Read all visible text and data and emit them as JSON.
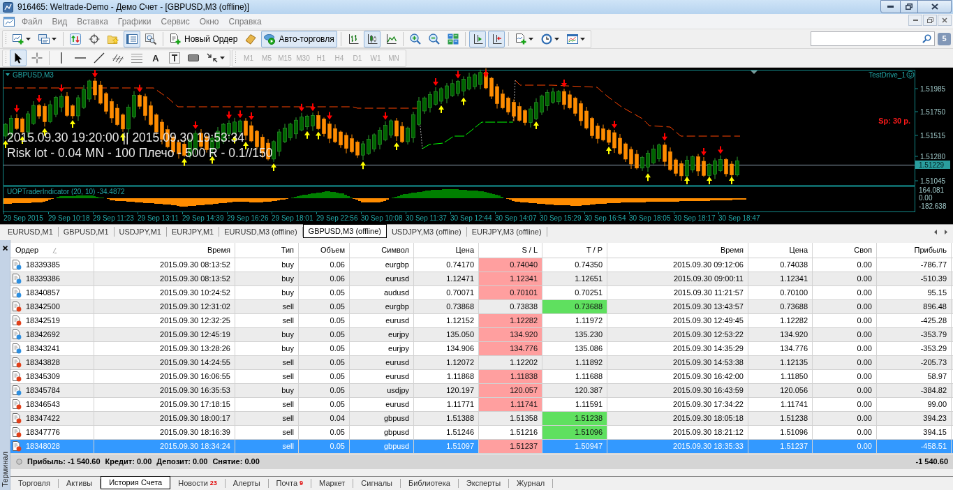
{
  "window": {
    "title": "916465: Weltrade-Demo - Демо Счет - [GBPUSD,M3 (offline)]"
  },
  "menu": [
    "Файл",
    "Вид",
    "Вставка",
    "Графики",
    "Сервис",
    "Окно",
    "Справка"
  ],
  "toolbar": {
    "groups": [
      [
        {
          "kind": "newchart",
          "pressed": false,
          "dropdown": true
        },
        {
          "kind": "profiles",
          "pressed": false,
          "dropdown": true
        }
      ],
      [
        {
          "kind": "market",
          "pressed": false
        },
        {
          "kind": "navigator",
          "pressed": false
        },
        {
          "kind": "favorites",
          "pressed": false
        },
        {
          "kind": "terminal",
          "pressed": true
        },
        {
          "kind": "tester",
          "pressed": false
        }
      ],
      [
        {
          "kind": "order",
          "label": "Новый Ордер",
          "pressed": false
        },
        {
          "kind": "editor",
          "pressed": false
        },
        {
          "kind": "autotrade",
          "label": "Авто-торговля",
          "pressed": true
        }
      ],
      [
        {
          "kind": "bars",
          "pressed": false
        },
        {
          "kind": "candles",
          "pressed": true
        },
        {
          "kind": "line",
          "pressed": false
        }
      ],
      [
        {
          "kind": "zoomin",
          "pressed": false
        },
        {
          "kind": "zoomout",
          "pressed": false
        },
        {
          "kind": "tile",
          "pressed": false
        }
      ],
      [
        {
          "kind": "shift",
          "pressed": true
        },
        {
          "kind": "autoscroll",
          "pressed": true
        }
      ],
      [
        {
          "kind": "indicators",
          "pressed": false,
          "dropdown": true
        },
        {
          "kind": "periods",
          "pressed": false,
          "dropdown": true
        },
        {
          "kind": "templates",
          "pressed": false,
          "dropdown": true
        }
      ]
    ]
  },
  "notifications": "5",
  "drawing_tools": {
    "groups": [
      [
        {
          "kind": "cursor",
          "selected": true
        },
        {
          "kind": "crosshair",
          "selected": false
        }
      ],
      [
        {
          "kind": "vline",
          "selected": false
        },
        {
          "kind": "hline",
          "selected": false
        },
        {
          "kind": "trendline",
          "selected": false
        },
        {
          "kind": "fibofan",
          "selected": false
        },
        {
          "kind": "fibo",
          "selected": false
        },
        {
          "kind": "text",
          "glyph": "A",
          "selected": false
        },
        {
          "kind": "label",
          "selected": false
        },
        {
          "kind": "rectangle",
          "selected": false
        },
        {
          "kind": "arrows",
          "selected": false,
          "dropdown": true
        }
      ]
    ]
  },
  "timeframes": [
    {
      "label": "M1",
      "disabled": true
    },
    {
      "label": "M5",
      "disabled": true
    },
    {
      "label": "M15",
      "disabled": true
    },
    {
      "label": "M30",
      "disabled": true
    },
    {
      "label": "H1",
      "disabled": true
    },
    {
      "label": "H4",
      "disabled": true
    },
    {
      "label": "D1",
      "disabled": true
    },
    {
      "label": "W1",
      "disabled": true
    },
    {
      "label": "MN",
      "disabled": true
    }
  ],
  "chart": {
    "symbol": "GBPUSD,M3",
    "expert": "TestDrive_1",
    "spread": "Sp: 30 p.",
    "info_lines": [
      "2015.09.30 19:20:00 || 2015.09.30 19:53:34",
      "Risk lot - 0.04 MN - 100 Плечо - 500 R - 0.1//150"
    ],
    "price_ticks": [
      "1.51985",
      "1.51750",
      "1.51515",
      "1.51280",
      "1.51045"
    ],
    "current_price": "1.51229",
    "indicator": {
      "label": "UOPTraderIndicator (20, 10) -34.4872",
      "ticks": [
        "164.081",
        "0.00",
        "-182.638"
      ]
    },
    "time_labels": [
      "29 Sep 2015",
      "29 Sep 10:18",
      "29 Sep 11:23",
      "29 Sep 13:11",
      "29 Sep 14:39",
      "29 Sep 16:26",
      "29 Sep 18:01",
      "29 Sep 22:56",
      "30 Sep 10:08",
      "30 Sep 11:37",
      "30 Sep 12:44",
      "30 Sep 14:07",
      "30 Sep 15:29",
      "30 Sep 16:54",
      "30 Sep 18:05",
      "30 Sep 18:17",
      "30 Sep 18:47"
    ]
  },
  "chart_tabs": [
    {
      "label": "EURUSD,M1",
      "selected": false
    },
    {
      "label": "GBPUSD,M1",
      "selected": false
    },
    {
      "label": "USDJPY,M1",
      "selected": false
    },
    {
      "label": "EURJPY,M1",
      "selected": false
    },
    {
      "label": "EURUSD,M3 (offline)",
      "selected": false
    },
    {
      "label": "GBPUSD,M3 (offline)",
      "selected": true
    },
    {
      "label": "USDJPY,M3 (offline)",
      "selected": false
    },
    {
      "label": "EURJPY,M3 (offline)",
      "selected": false
    }
  ],
  "terminal": {
    "title": "Терминал",
    "columns": [
      {
        "label": "Ордер",
        "sorted": true
      },
      {
        "label": "Время",
        "sorted": false
      },
      {
        "label": "Тип",
        "sorted": false
      },
      {
        "label": "Объем",
        "sorted": false
      },
      {
        "label": "Символ",
        "sorted": false
      },
      {
        "label": "Цена",
        "sorted": false
      },
      {
        "label": "S / L",
        "sorted": false
      },
      {
        "label": "T / P",
        "sorted": false
      },
      {
        "label": "Время",
        "sorted": false
      },
      {
        "label": "Цена",
        "sorted": false
      },
      {
        "label": "Своп",
        "sorted": false
      },
      {
        "label": "Прибыль",
        "sorted": false
      }
    ],
    "rows": [
      {
        "cells": [
          "18339385",
          "2015.09.30 08:13:52",
          "buy",
          "0.06",
          "eurgbp",
          "0.74170",
          "0.74040",
          "0.74350",
          "2015.09.30 09:12:06",
          "0.74038",
          "0.00",
          "-786.77"
        ],
        "color": "#2d8fe0",
        "sl_hit": true,
        "tp_hit": false,
        "selected": false
      },
      {
        "cells": [
          "18339386",
          "2015.09.30 08:13:52",
          "buy",
          "0.06",
          "eurusd",
          "1.12471",
          "1.12341",
          "1.12651",
          "2015.09.30 09:00:11",
          "1.12341",
          "0.00",
          "-510.39"
        ],
        "color": "#2d8fe0",
        "sl_hit": true,
        "tp_hit": false,
        "selected": false
      },
      {
        "cells": [
          "18340857",
          "2015.09.30 10:24:52",
          "buy",
          "0.05",
          "audusd",
          "0.70071",
          "0.70101",
          "0.70251",
          "2015.09.30 11:21:57",
          "0.70100",
          "0.00",
          "95.15"
        ],
        "color": "#2d8fe0",
        "sl_hit": true,
        "tp_hit": false,
        "selected": false
      },
      {
        "cells": [
          "18342500",
          "2015.09.30 12:31:02",
          "sell",
          "0.05",
          "eurgbp",
          "0.73868",
          "0.73838",
          "0.73688",
          "2015.09.30 13:43:57",
          "0.73688",
          "0.00",
          "896.48"
        ],
        "color": "#e2401a",
        "sl_hit": false,
        "tp_hit": true,
        "selected": false
      },
      {
        "cells": [
          "18342519",
          "2015.09.30 12:32:25",
          "sell",
          "0.05",
          "eurusd",
          "1.12152",
          "1.12282",
          "1.11972",
          "2015.09.30 12:49:45",
          "1.12282",
          "0.00",
          "-425.28"
        ],
        "color": "#e2401a",
        "sl_hit": true,
        "tp_hit": false,
        "selected": false
      },
      {
        "cells": [
          "18342692",
          "2015.09.30 12:45:19",
          "buy",
          "0.05",
          "eurjpy",
          "135.050",
          "134.920",
          "135.230",
          "2015.09.30 12:53:22",
          "134.920",
          "0.00",
          "-353.79"
        ],
        "color": "#2d8fe0",
        "sl_hit": true,
        "tp_hit": false,
        "selected": false
      },
      {
        "cells": [
          "18343241",
          "2015.09.30 13:28:26",
          "buy",
          "0.05",
          "eurjpy",
          "134.906",
          "134.776",
          "135.086",
          "2015.09.30 14:35:29",
          "134.776",
          "0.00",
          "-353.29"
        ],
        "color": "#2d8fe0",
        "sl_hit": true,
        "tp_hit": false,
        "selected": false
      },
      {
        "cells": [
          "18343828",
          "2015.09.30 14:24:55",
          "sell",
          "0.05",
          "eurusd",
          "1.12072",
          "1.12202",
          "1.11892",
          "2015.09.30 14:53:38",
          "1.12135",
          "0.00",
          "-205.73"
        ],
        "color": "#e2401a",
        "sl_hit": false,
        "tp_hit": false,
        "selected": false
      },
      {
        "cells": [
          "18345309",
          "2015.09.30 16:06:55",
          "sell",
          "0.05",
          "eurusd",
          "1.11868",
          "1.11838",
          "1.11688",
          "2015.09.30 16:42:00",
          "1.11850",
          "0.00",
          "58.97"
        ],
        "color": "#e2401a",
        "sl_hit": true,
        "tp_hit": false,
        "selected": false
      },
      {
        "cells": [
          "18345784",
          "2015.09.30 16:35:53",
          "buy",
          "0.05",
          "usdjpy",
          "120.197",
          "120.057",
          "120.387",
          "2015.09.30 16:43:59",
          "120.056",
          "0.00",
          "-384.82"
        ],
        "color": "#2d8fe0",
        "sl_hit": true,
        "tp_hit": false,
        "selected": false
      },
      {
        "cells": [
          "18346543",
          "2015.09.30 17:18:15",
          "sell",
          "0.05",
          "eurusd",
          "1.11771",
          "1.11741",
          "1.11591",
          "2015.09.30 17:34:22",
          "1.11741",
          "0.00",
          "99.00"
        ],
        "color": "#e2401a",
        "sl_hit": true,
        "tp_hit": false,
        "selected": false
      },
      {
        "cells": [
          "18347422",
          "2015.09.30 18:00:17",
          "sell",
          "0.04",
          "gbpusd",
          "1.51388",
          "1.51358",
          "1.51238",
          "2015.09.30 18:05:18",
          "1.51238",
          "0.00",
          "394.23"
        ],
        "color": "#e2401a",
        "sl_hit": false,
        "tp_hit": true,
        "selected": false
      },
      {
        "cells": [
          "18347776",
          "2015.09.30 18:16:39",
          "sell",
          "0.05",
          "gbpusd",
          "1.51246",
          "1.51216",
          "1.51096",
          "2015.09.30 18:21:12",
          "1.51096",
          "0.00",
          "394.15"
        ],
        "color": "#e2401a",
        "sl_hit": false,
        "tp_hit": true,
        "selected": false
      },
      {
        "cells": [
          "18348028",
          "2015.09.30 18:34:24",
          "sell",
          "0.05",
          "gbpusd",
          "1.51097",
          "1.51237",
          "1.50947",
          "2015.09.30 18:35:33",
          "1.51237",
          "0.00",
          "-458.51"
        ],
        "color": "#e2401a",
        "sl_hit": true,
        "tp_hit": false,
        "selected": true
      }
    ],
    "summary": {
      "items": [
        "Прибыль: -1 540.60",
        "Кредит: 0.00",
        "Депозит: 0.00",
        "Снятие: 0.00"
      ],
      "total": "-1 540.60"
    },
    "tabs": [
      {
        "label": "Торговля",
        "selected": false
      },
      {
        "label": "Активы",
        "selected": false
      },
      {
        "label": "История Счета",
        "selected": true
      },
      {
        "label": "Новости",
        "count": "23",
        "selected": false
      },
      {
        "label": "Алерты",
        "selected": false
      },
      {
        "label": "Почта",
        "count": "9",
        "selected": false
      },
      {
        "label": "Маркет",
        "selected": false
      },
      {
        "label": "Сигналы",
        "selected": false
      },
      {
        "label": "Библиотека",
        "selected": false
      },
      {
        "label": "Эксперты",
        "selected": false
      },
      {
        "label": "Журнал",
        "selected": false
      }
    ]
  }
}
